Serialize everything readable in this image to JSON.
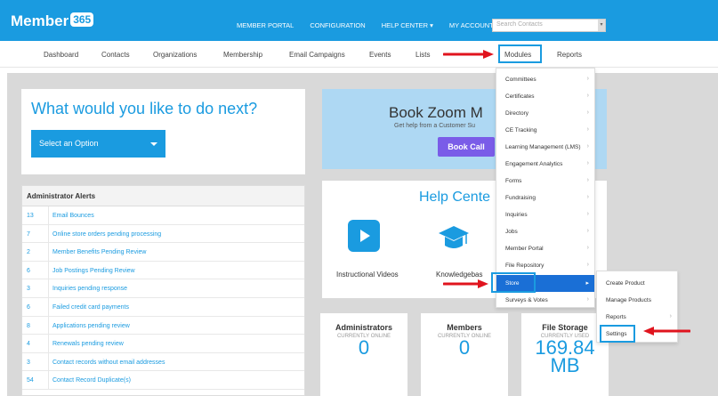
{
  "header": {
    "logo_text": "Member",
    "logo_num": "365",
    "nav": [
      "MEMBER PORTAL",
      "CONFIGURATION",
      "HELP CENTER ▾",
      "MY ACCOUNT ▾"
    ],
    "search_placeholder": "Search Contacts"
  },
  "subnav": {
    "dashboard": "Dashboard",
    "contacts": "Contacts",
    "organizations": "Organizations",
    "membership": "Membership",
    "email_campaigns": "Email Campaigns",
    "events": "Events",
    "lists": "Lists",
    "modules": "Modules",
    "reports": "Reports"
  },
  "main": {
    "what_next": "What would you like to do next?",
    "select_option": "Select an Option"
  },
  "alerts": {
    "title": "Administrator Alerts",
    "rows": [
      {
        "count": "13",
        "text": "Email Bounces"
      },
      {
        "count": "7",
        "text": "Online store orders pending processing"
      },
      {
        "count": "2",
        "text": "Member Benefits Pending Review"
      },
      {
        "count": "6",
        "text": "Job Postings Pending Review"
      },
      {
        "count": "3",
        "text": "Inquiries pending response"
      },
      {
        "count": "6",
        "text": "Failed credit card payments"
      },
      {
        "count": "8",
        "text": "Applications pending review"
      },
      {
        "count": "4",
        "text": "Renewals pending review"
      },
      {
        "count": "3",
        "text": "Contact records without email addresses"
      },
      {
        "count": "54",
        "text": "Contact Record Duplicate(s)"
      }
    ]
  },
  "zoom": {
    "title": "Book Zoom M",
    "subtitle": "Get help from a Customer Su",
    "button": "Book Call"
  },
  "help": {
    "title": "Help Cente",
    "videos": "Instructional Videos",
    "kb": "Knowledgebas"
  },
  "stats": [
    {
      "title": "Administrators",
      "sub": "CURRENTLY ONLINE",
      "value": "0"
    },
    {
      "title": "Members",
      "sub": "CURRENTLY ONLINE",
      "value": "0"
    },
    {
      "title": "File Storage",
      "sub": "CURRENTLY USED",
      "value": "169.84",
      "unit": "MB"
    }
  ],
  "modules_menu": [
    {
      "label": "Committees"
    },
    {
      "label": "Certificates"
    },
    {
      "label": "Directory"
    },
    {
      "label": "CE Tracking"
    },
    {
      "label": "Learning Management (LMS)"
    },
    {
      "label": "Engagement Analytics"
    },
    {
      "label": "Forms"
    },
    {
      "label": "Fundraising"
    },
    {
      "label": "Inquiries"
    },
    {
      "label": "Jobs"
    },
    {
      "label": "Member Portal"
    },
    {
      "label": "File Repository"
    },
    {
      "label": "Store"
    },
    {
      "label": "Surveys & Votes"
    }
  ],
  "store_menu": [
    {
      "label": "Create Product"
    },
    {
      "label": "Manage Products"
    },
    {
      "label": "Reports"
    },
    {
      "label": "Settings"
    }
  ],
  "colors": {
    "brand": "#1a9be0",
    "accent": "#7a5ce8",
    "annotation": "#e0141e"
  }
}
